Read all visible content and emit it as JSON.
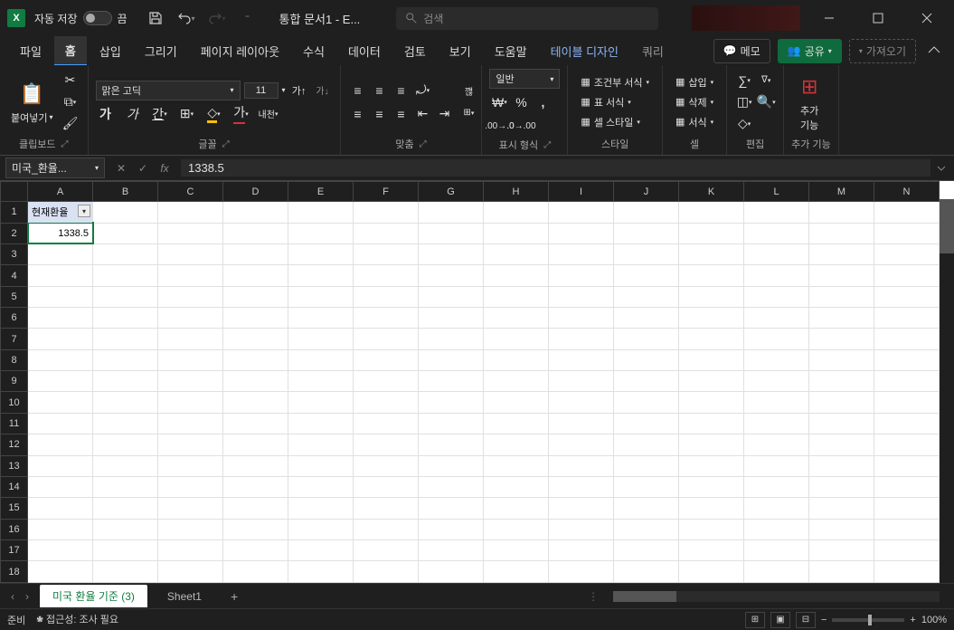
{
  "titlebar": {
    "autosave_label": "자동 저장",
    "autosave_state": "끔",
    "doc_title": "통합 문서1 - E...",
    "search_placeholder": "검색"
  },
  "ribbon_tabs": [
    "파일",
    "홈",
    "삽입",
    "그리기",
    "페이지 레이아웃",
    "수식",
    "데이터",
    "검토",
    "보기",
    "도움말",
    "테이블 디자인",
    "쿼리"
  ],
  "ribbon_right": {
    "memo": "메모",
    "share": "공유",
    "get": "가져오기"
  },
  "ribbon_groups": {
    "clipboard": {
      "paste": "붙여넣기",
      "label": "클립보드"
    },
    "font": {
      "name": "맑은 고딕",
      "size": "11",
      "label": "글꼴",
      "korean_label": "내천"
    },
    "align": {
      "label": "맞춤"
    },
    "number": {
      "format": "일반",
      "label": "표시 형식"
    },
    "styles": {
      "cond": "조건부 서식",
      "table": "표 서식",
      "cell": "셀 스타일",
      "label": "스타일"
    },
    "cells": {
      "insert": "삽입",
      "delete": "삭제",
      "format": "서식",
      "label": "셀"
    },
    "editing": {
      "label": "편집"
    },
    "addins": {
      "main": "추가\n기능",
      "label": "추가 기능"
    }
  },
  "formula_bar": {
    "name_box": "미국_환율...",
    "value": "1338.5"
  },
  "grid": {
    "columns": [
      "A",
      "B",
      "C",
      "D",
      "E",
      "F",
      "G",
      "H",
      "I",
      "J",
      "K",
      "L",
      "M",
      "N"
    ],
    "a1": "현재환율",
    "a2": "1338.5"
  },
  "sheet_tabs": {
    "active": "미국 환율 기준 (3)",
    "other": "Sheet1"
  },
  "statusbar": {
    "ready": "준비",
    "accessibility": "접근성: 조사 필요",
    "zoom": "100%"
  }
}
